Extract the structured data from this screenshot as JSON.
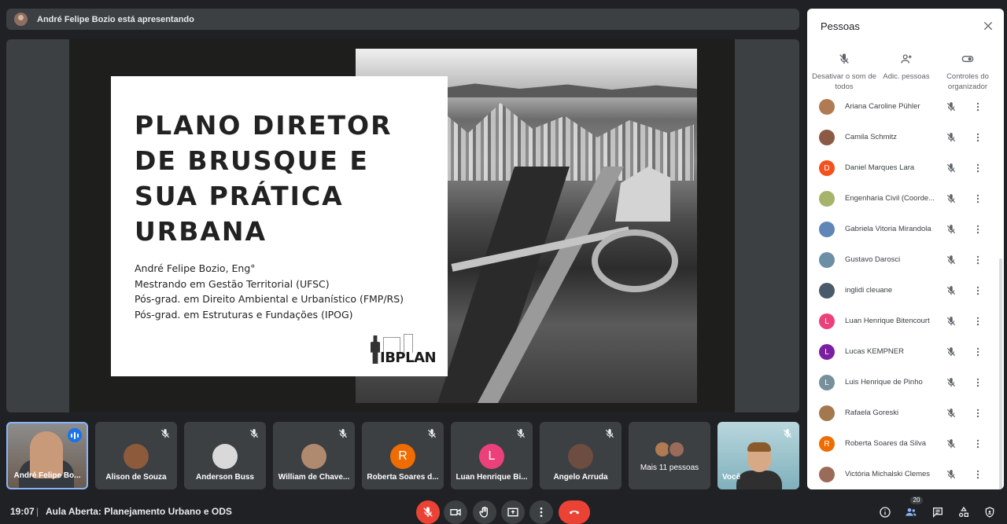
{
  "presenting_banner": "André Felipe Bozio está apresentando",
  "slide": {
    "title": "PLANO DIRETOR\nDE BRUSQUE E\nSUA PRÁTICA\nURBANA",
    "lines": [
      "André Felipe Bozio, Eng°",
      "Mestrando em Gestão Territorial (UFSC)",
      "Pós-grad. em Direito Ambiental e Urbanístico (FMP/RS)",
      "Pós-grad. em Estruturas e Fundações (IPOG)"
    ],
    "logo_text": "IBPLAN",
    "logo_tagline": "INSTITUTO BRASILEIRO DE PLANEJAMENTO"
  },
  "tiles": [
    {
      "name": "André Felipe Bo...",
      "kind": "presenter"
    },
    {
      "name": "Alison de Souza",
      "kind": "photo",
      "color": "#8d5a3b"
    },
    {
      "name": "Anderson Buss",
      "kind": "photo",
      "color": "#d9d9d9"
    },
    {
      "name": "William de Chave...",
      "kind": "photo",
      "color": "#b08a6e"
    },
    {
      "name": "Roberta Soares d...",
      "kind": "letter",
      "letter": "R",
      "color": "#ef6c00"
    },
    {
      "name": "Luan Henrique Bi...",
      "kind": "letter",
      "letter": "L",
      "color": "#ec407a"
    },
    {
      "name": "Ângelo Arruda",
      "kind": "photo",
      "color": "#6d4c41"
    },
    {
      "name": "Mais 11 pessoas",
      "kind": "more"
    },
    {
      "name": "Você",
      "kind": "you"
    }
  ],
  "bottom": {
    "time": "19:07",
    "separator": "|",
    "meeting_title": "Aula Aberta: Planejamento Urbano e ODS",
    "participants_count": "20"
  },
  "panel": {
    "title": "Pessoas",
    "actions": [
      {
        "label": "Desativar o som de todos",
        "icon": "mic-off-icon"
      },
      {
        "label": "Adic. pessoas",
        "icon": "person-add-icon"
      },
      {
        "label": "Controles do organizador",
        "icon": "toggle-icon"
      }
    ],
    "people": [
      {
        "name": "Ariana Caroline Pühler",
        "avatar": "photo",
        "color": "#b07a52"
      },
      {
        "name": "Camila Schmitz",
        "avatar": "photo",
        "color": "#8a5a44"
      },
      {
        "name": "Daniel Marques Lara",
        "avatar": "letter",
        "letter": "D",
        "color": "#f4511e"
      },
      {
        "name": "Engenharia Civil (Coorde...",
        "avatar": "photo",
        "color": "#a5b36b"
      },
      {
        "name": "Gabriela Vitoria Mirandola",
        "avatar": "photo",
        "color": "#5f86b6"
      },
      {
        "name": "Gustavo Darosci",
        "avatar": "photo",
        "color": "#6d8fa6"
      },
      {
        "name": "inglidi cleuane",
        "avatar": "photo",
        "color": "#4a5a6a"
      },
      {
        "name": "Luan Henrique Bitencourt",
        "avatar": "letter",
        "letter": "L",
        "color": "#ec407a"
      },
      {
        "name": "Lucas KEMPNER",
        "avatar": "letter",
        "letter": "L",
        "color": "#7b1fa2"
      },
      {
        "name": "Luis Henrique de Pinho",
        "avatar": "letter",
        "letter": "L",
        "color": "#78909c"
      },
      {
        "name": "Rafaela Goreski",
        "avatar": "photo",
        "color": "#a4784f"
      },
      {
        "name": "Roberta Soares da Silva",
        "avatar": "letter",
        "letter": "R",
        "color": "#ef6c00"
      },
      {
        "name": "Victória Michalski Clemes",
        "avatar": "photo",
        "color": "#9b6b5a"
      }
    ]
  },
  "colors": {
    "background": "#202124",
    "surface": "#3c4043",
    "danger": "#ea4335",
    "accent": "#8ab4f8"
  }
}
